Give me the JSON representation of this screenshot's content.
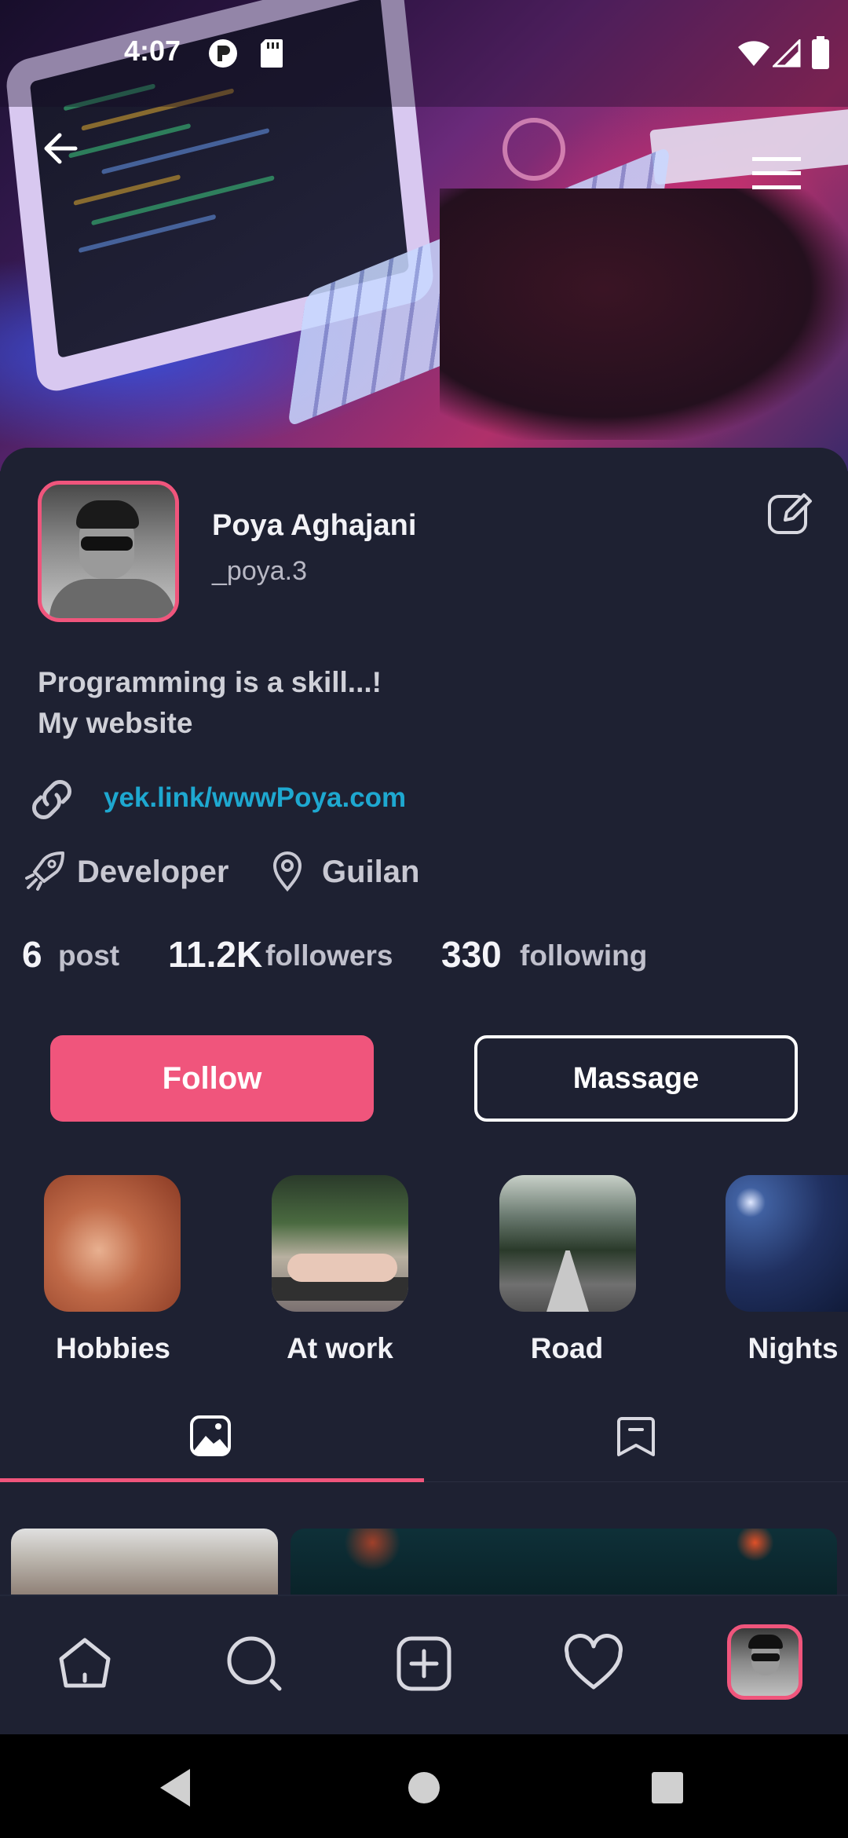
{
  "status_bar": {
    "time": "4:07",
    "icons": [
      "notification-app-icon",
      "sd-card-icon",
      "wifi-icon",
      "signal-icon",
      "battery-icon"
    ]
  },
  "header": {
    "back_icon": "arrow-left-icon",
    "menu_icon": "hamburger-menu-icon"
  },
  "profile": {
    "name": "Poya Aghajani",
    "username": "_poya.3",
    "bio_line1": "Programming is a skill...!",
    "bio_line2": "My website",
    "link": "yek.link/wwwPoya.com",
    "occupation": "Developer",
    "location": "Guilan",
    "edit_icon": "edit-icon"
  },
  "stats": {
    "posts_count": "6",
    "posts_label": "post",
    "followers_count": "11.2K",
    "followers_label": "followers",
    "following_count": "330",
    "following_label": "following"
  },
  "actions": {
    "follow_label": "Follow",
    "message_label": "Massage"
  },
  "highlights": [
    {
      "label": "Hobbies"
    },
    {
      "label": "At work"
    },
    {
      "label": "Road"
    },
    {
      "label": "Nights"
    }
  ],
  "tabs": [
    {
      "icon": "photos-icon",
      "active": true
    },
    {
      "icon": "saved-icon",
      "active": false
    }
  ],
  "bottom_nav": [
    "home-icon",
    "search-icon",
    "add-post-icon",
    "heart-icon",
    "profile-avatar"
  ],
  "colors": {
    "accent": "#f0557c",
    "background": "#1e2132",
    "link": "#1ea8d0"
  }
}
